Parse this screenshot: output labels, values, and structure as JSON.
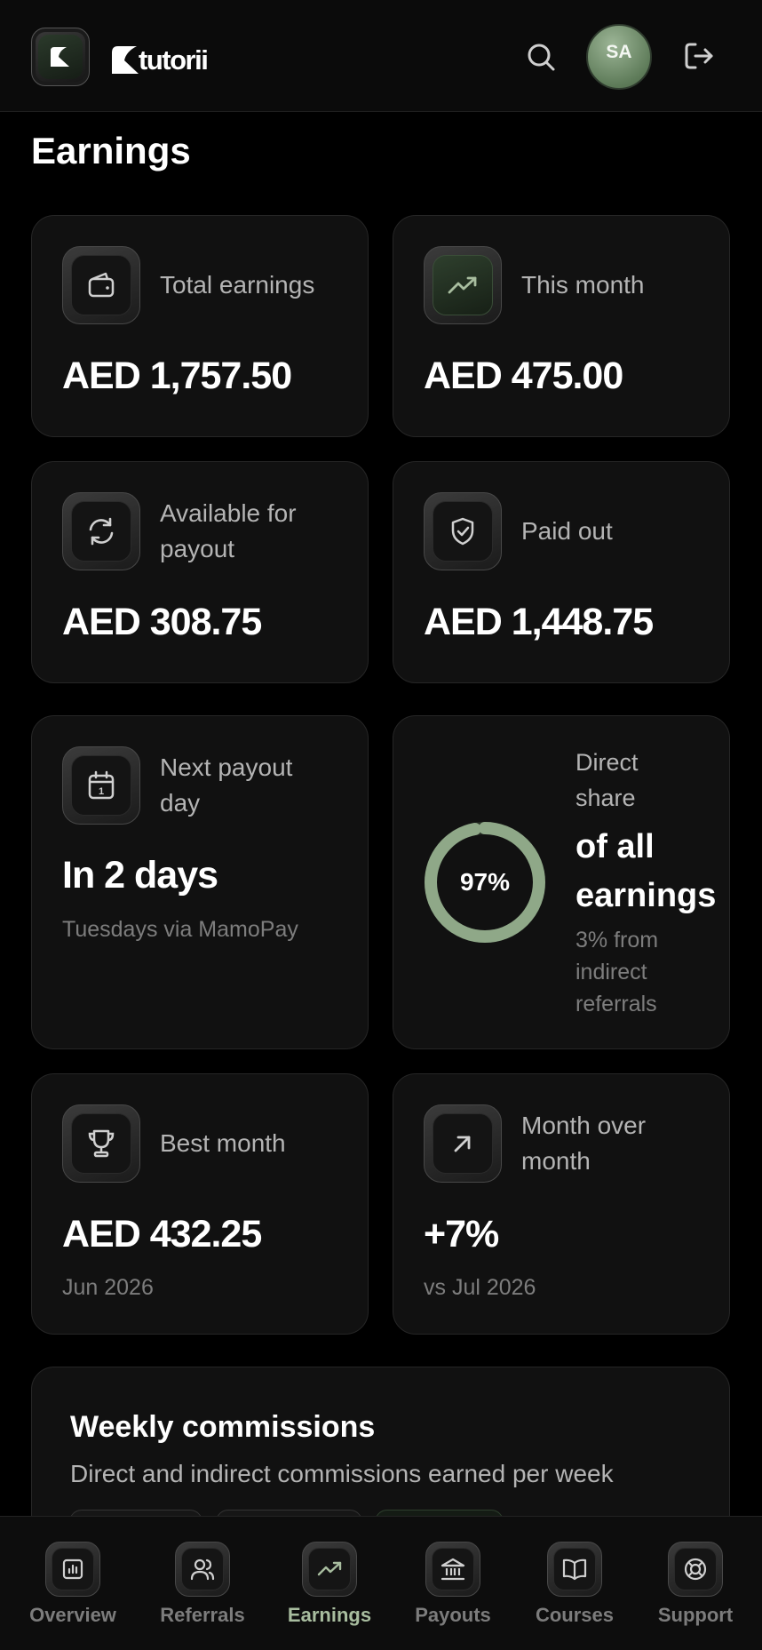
{
  "header": {
    "brand": "tutorii",
    "avatar_initials": "SA"
  },
  "page": {
    "title": "Earnings"
  },
  "stats": [
    {
      "label": "Total earnings",
      "value": "AED 1,757.50",
      "icon": "wallet-icon"
    },
    {
      "label": "This month",
      "value": "AED 475.00",
      "icon": "trending-up-icon"
    },
    {
      "label": "Available for payout",
      "value": "AED 308.75",
      "icon": "refresh-icon"
    },
    {
      "label": "Paid out",
      "value": "AED 1,448.75",
      "icon": "shield-check-icon"
    }
  ],
  "next_payout": {
    "label": "Next payout day",
    "value": "In 2 days",
    "sub": "Tuesdays via MamoPay",
    "icon": "calendar-icon"
  },
  "direct_share": {
    "percent": 97,
    "percent_text": "97%",
    "label": "Direct share",
    "big": "of all earnings",
    "sub": "3% from indirect referrals",
    "ring_color": "#8fa888"
  },
  "best_month": {
    "label": "Best month",
    "value": "AED 432.25",
    "sub": "Jun 2026",
    "icon": "trophy-icon"
  },
  "month_over_month": {
    "label": "Month over month",
    "value": "+7%",
    "sub": "vs Jul 2026",
    "icon": "arrow-up-right-icon"
  },
  "weekly": {
    "title": "Weekly commissions",
    "subtitle": "Direct and indirect commissions earned per week"
  },
  "nav": {
    "active": "Earnings",
    "items": [
      {
        "label": "Overview",
        "icon": "bar-chart-icon"
      },
      {
        "label": "Referrals",
        "icon": "users-icon"
      },
      {
        "label": "Earnings",
        "icon": "trending-up-icon"
      },
      {
        "label": "Payouts",
        "icon": "bank-icon"
      },
      {
        "label": "Courses",
        "icon": "book-open-icon"
      },
      {
        "label": "Support",
        "icon": "life-buoy-icon"
      }
    ]
  },
  "colors": {
    "accent": "#a8bd9f",
    "card_bg": "#111111",
    "border": "#262626"
  }
}
